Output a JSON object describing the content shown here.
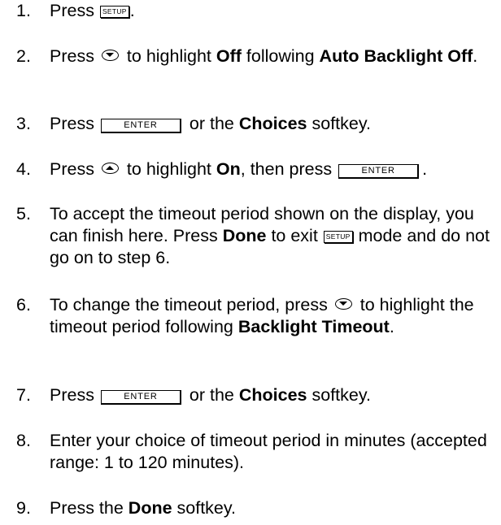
{
  "steps": [
    {
      "num": "1.",
      "parts": [
        {
          "t": "Press "
        },
        {
          "key": "SETUP"
        },
        {
          "t": "."
        }
      ]
    },
    {
      "num": "2.",
      "parts": [
        {
          "t": "Press "
        },
        {
          "arrow": "down"
        },
        {
          "t": " to highlight "
        },
        {
          "b": "Off"
        },
        {
          "t": " following "
        },
        {
          "b": "Auto Backlight Off"
        },
        {
          "t": "."
        }
      ]
    },
    {
      "num": "3.",
      "parts": [
        {
          "t": "Press "
        },
        {
          "enter": "ENTER"
        },
        {
          "t": " or the "
        },
        {
          "b": "Choices"
        },
        {
          "t": " softkey."
        }
      ]
    },
    {
      "num": "4.",
      "parts": [
        {
          "t": "Press "
        },
        {
          "arrow": "up"
        },
        {
          "t": " to highlight "
        },
        {
          "b": "On"
        },
        {
          "t": ", then press "
        },
        {
          "enter": "ENTER"
        },
        {
          "t": "."
        }
      ]
    },
    {
      "num": "5.",
      "parts": [
        {
          "t": "To accept the timeout period shown on the display, you can finish here. Press "
        },
        {
          "b": "Done"
        },
        {
          "t": " to exit "
        },
        {
          "key": "SETUP"
        },
        {
          "t": " mode and do not go on to step 6."
        }
      ]
    },
    {
      "num": "6.",
      "parts": [
        {
          "t": "To change the timeout period, press "
        },
        {
          "arrow": "down"
        },
        {
          "t": " to highlight the timeout period following "
        },
        {
          "b": "Backlight Timeout"
        },
        {
          "t": "."
        }
      ]
    },
    {
      "num": "7.",
      "parts": [
        {
          "t": "Press "
        },
        {
          "enter": "ENTER"
        },
        {
          "t": " or the "
        },
        {
          "b": "Choices"
        },
        {
          "t": " softkey."
        }
      ]
    },
    {
      "num": "8.",
      "parts": [
        {
          "t": "Enter your choice of timeout period in minutes (accepted range: 1 to 120 minutes)."
        }
      ]
    },
    {
      "num": "9.",
      "parts": [
        {
          "t": "Press the "
        },
        {
          "b": "Done"
        },
        {
          "t": " softkey."
        }
      ]
    }
  ]
}
